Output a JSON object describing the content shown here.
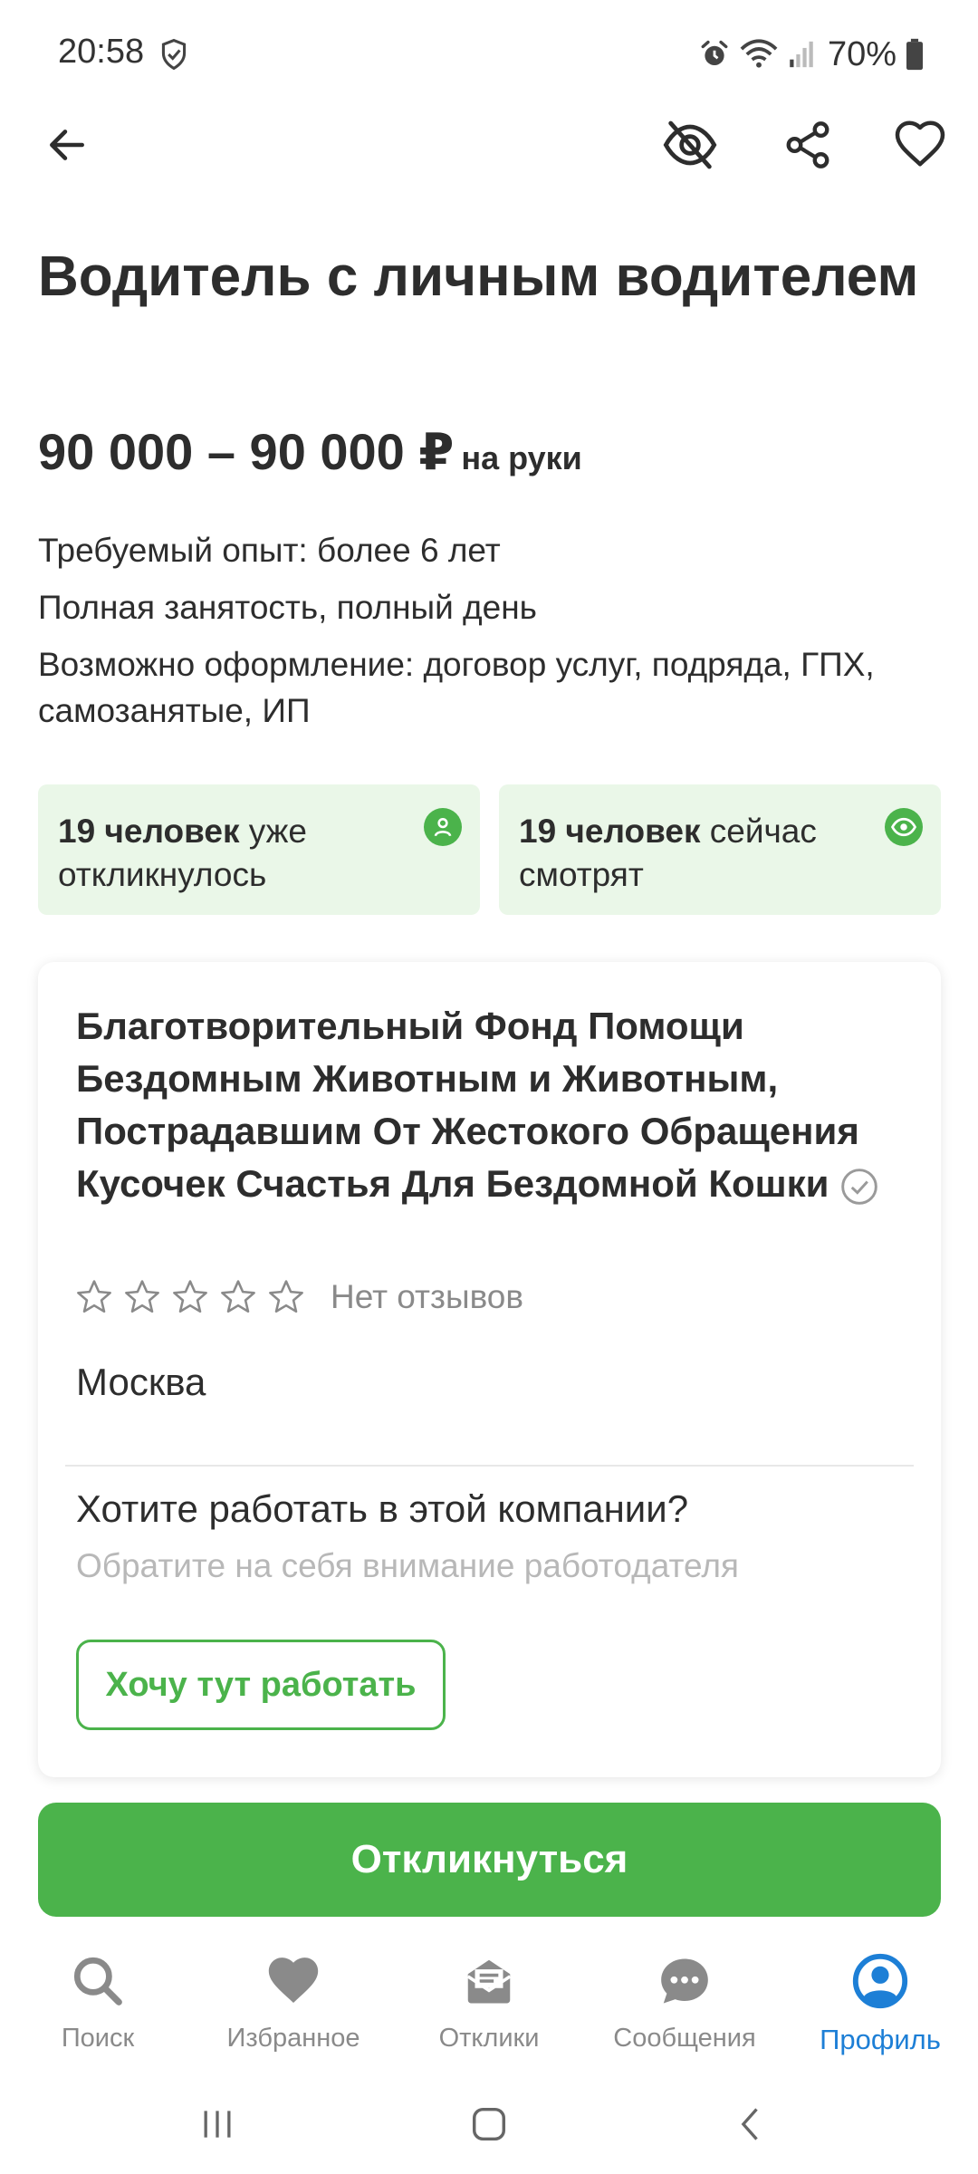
{
  "status_bar": {
    "time": "20:58",
    "battery": "70%",
    "icons": [
      "shield-icon",
      "alarm-icon",
      "wifi-icon",
      "signal-icon",
      "battery-icon"
    ]
  },
  "toolbar": {
    "icons": [
      "back-arrow-icon",
      "hide-eye-icon",
      "share-icon",
      "heart-icon"
    ]
  },
  "vacancy": {
    "title": "Водитель с личным водителем",
    "salary": "90 000 – 90 000 ₽",
    "salary_suffix": "на руки",
    "experience": "Требуемый опыт: более 6 лет",
    "employment": "Полная занятость, полный день",
    "contract": "Возможно оформление: договор услуг, подряда, ГПХ, самозанятые, ИП"
  },
  "stats": {
    "applied_bold": "19 человек",
    "applied_rest": "уже откликнулось",
    "viewing_bold": "19 человек",
    "viewing_rest": "сейчас смотрят"
  },
  "company": {
    "name": "Благотворительный Фонд Помощи Бездомным Животным и Животным, Пострадавшим От Жестокого Обращения Кусочек Счастья Для Бездомной Кошки",
    "rating_stars": 0,
    "rating_max": 5,
    "reviews": "Нет отзывов",
    "city": "Москва",
    "want_title": "Хотите работать в этой компании?",
    "want_subtitle": "Обратите на себя внимание работодателя",
    "want_button": "Хочу тут работать"
  },
  "apply_button": "Откликнуться",
  "bottom_nav": {
    "items": [
      {
        "label": "Поиск",
        "icon": "search-icon"
      },
      {
        "label": "Избранное",
        "icon": "heart-icon"
      },
      {
        "label": "Отклики",
        "icon": "responses-icon"
      },
      {
        "label": "Сообщения",
        "icon": "chat-icon"
      },
      {
        "label": "Профиль",
        "icon": "profile-icon",
        "active": true
      }
    ]
  },
  "colors": {
    "accent": "#4bb34b",
    "stat_bg": "#eaf7e8",
    "active_nav": "#1d7fd6",
    "text": "#2d2d2d",
    "muted": "#8a8a8a"
  }
}
